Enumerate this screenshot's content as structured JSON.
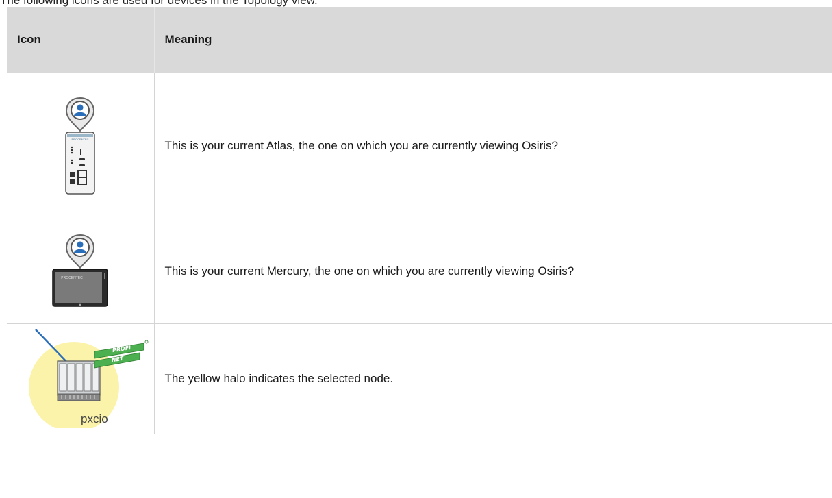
{
  "intro": "The following icons are used for devices in the Topology view.",
  "table": {
    "headers": {
      "icon": "Icon",
      "meaning": "Meaning"
    },
    "rows": [
      {
        "icon": "atlas-device-current-icon",
        "meaning": "This is your current Atlas, the one on which you are currently viewing Osiris?"
      },
      {
        "icon": "mercury-panel-current-icon",
        "meaning": "This is your current Mercury, the one on which you are currently viewing Osiris?"
      },
      {
        "icon": "profinet-node-selected-halo-icon",
        "meaning": "The yellow halo indicates the selected node.",
        "icon_label": "pxcio"
      }
    ]
  },
  "colors": {
    "header_bg": "#d9d9d9",
    "halo": "#fbf3a9",
    "pin_blue": "#2a6db8",
    "profinet_green": "#4caf50"
  }
}
